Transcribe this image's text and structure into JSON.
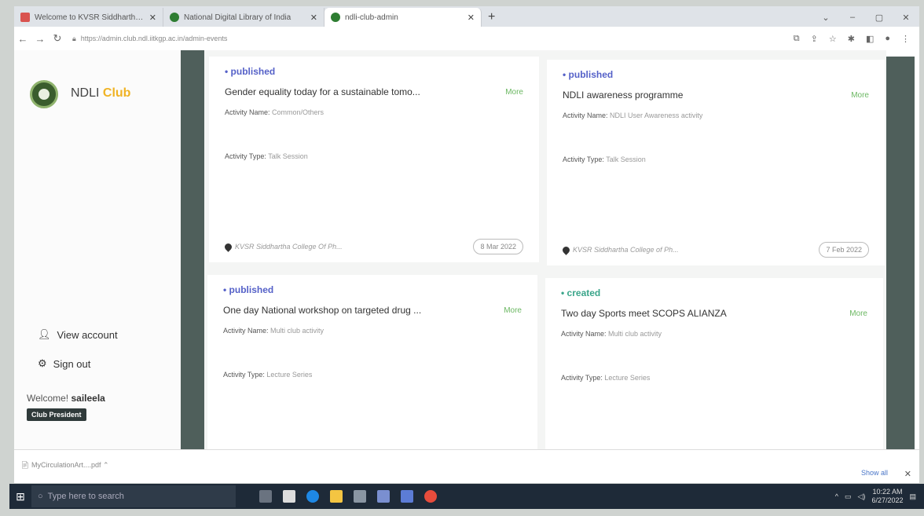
{
  "browser": {
    "tabs": [
      {
        "title": "Welcome to KVSR Siddhartha C",
        "active": false
      },
      {
        "title": "National Digital Library of India",
        "active": false
      },
      {
        "title": "ndli-club-admin",
        "active": true
      }
    ],
    "url": "https://admin.club.ndl.iitkgp.ac.in/admin-events"
  },
  "sidebar": {
    "brand": "NDLI",
    "brand_accent": "Club",
    "view_account": "View account",
    "sign_out": "Sign out",
    "welcome_prefix": "Welcome!",
    "username": "saileela",
    "role": "Club President"
  },
  "events": [
    {
      "status": "published",
      "title": "Gender equality today for a sustainable tomo...",
      "more": "More",
      "activity_name_label": "Activity Name:",
      "activity_name": "Common/Others",
      "activity_type_label": "Activity Type:",
      "activity_type": "Talk Session",
      "location": "KVSR Siddhartha College Of Ph...",
      "date": "8 Mar 2022"
    },
    {
      "status": "published",
      "title": "NDLI awareness programme",
      "more": "More",
      "activity_name_label": "Activity Name:",
      "activity_name": "NDLI User Awareness activity",
      "activity_type_label": "Activity Type:",
      "activity_type": "Talk Session",
      "location": "KVSR Siddhartha College of Ph...",
      "date": "7 Feb 2022"
    },
    {
      "status": "published",
      "title": "One day National workshop on targeted drug ...",
      "more": "More",
      "activity_name_label": "Activity Name:",
      "activity_name": "Multi club activity",
      "activity_type_label": "Activity Type:",
      "activity_type": "Lecture Series"
    },
    {
      "status": "created",
      "title": "Two day Sports meet SCOPS ALIANZA",
      "more": "More",
      "activity_name_label": "Activity Name:",
      "activity_name": "Multi club activity",
      "activity_type_label": "Activity Type:",
      "activity_type": "Lecture Series"
    }
  ],
  "downloads": {
    "file": "MyCirculationArt....pdf",
    "show_all": "Show all"
  },
  "taskbar": {
    "search_placeholder": "Type here to search",
    "time": "10:22 AM",
    "date": "6/27/2022"
  },
  "colors": {
    "rail": "#4f5f5b",
    "published": "#5561c8",
    "created": "#3aa58a",
    "more": "#6cb863",
    "club": "#f0b324"
  }
}
